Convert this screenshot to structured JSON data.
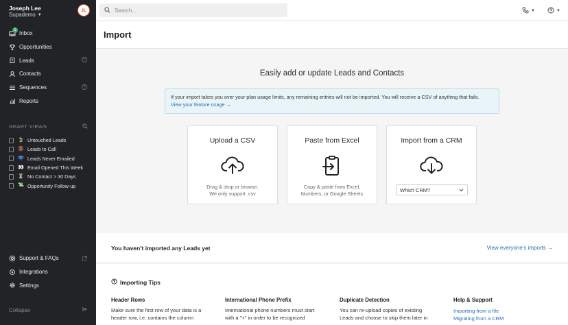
{
  "user": {
    "name": "Joseph Lee",
    "org": "Supademo",
    "initials": "JL"
  },
  "nav": [
    {
      "label": "Inbox",
      "icon": "inbox-icon",
      "badge": "1"
    },
    {
      "label": "Opportunities",
      "icon": "trophy-icon"
    },
    {
      "label": "Leads",
      "icon": "building-icon",
      "add": "+"
    },
    {
      "label": "Contacts",
      "icon": "person-icon"
    },
    {
      "label": "Sequences",
      "icon": "list-icon",
      "add": "+"
    },
    {
      "label": "Reports",
      "icon": "chart-icon"
    }
  ],
  "smart_views": {
    "header": "SMART VIEWS",
    "items": [
      {
        "label": "Untouched Leads",
        "emoji": "🍃"
      },
      {
        "label": "Leads to Call",
        "emoji": "📵"
      },
      {
        "label": "Leads Never Emailed",
        "emoji": "📪"
      },
      {
        "label": "Email Opened This Week",
        "emoji": "👀"
      },
      {
        "label": "No Contact > 30 Days",
        "emoji": "⏳"
      },
      {
        "label": "Opportunity Follow-up",
        "emoji": "💸"
      }
    ]
  },
  "bottom_nav": [
    {
      "label": "Support & FAQs",
      "icon": "lifebuoy-icon"
    },
    {
      "label": "Integrations",
      "icon": "plug-icon"
    },
    {
      "label": "Settings",
      "icon": "gear-icon"
    }
  ],
  "collapse_label": "Collapse",
  "search": {
    "placeholder": "Search..."
  },
  "page": {
    "title": "Import",
    "hero": "Easily add or update Leads and Contacts",
    "notice_text": "If your import takes you over your plan usage limits, any remaining entries will not be imported. You will receive a CSV of anything that fails.",
    "notice_link": "View your feature usage →"
  },
  "cards": [
    {
      "title": "Upload a CSV",
      "desc1": "Drag & drop or browse.",
      "desc2": "We only support .csv",
      "icon": "cloud-upload-icon"
    },
    {
      "title": "Paste from Excel",
      "desc1": "Copy & paste from Excel,",
      "desc2": "Numbers, or Google Sheets",
      "icon": "clipboard-paste-icon"
    },
    {
      "title": "Import from a CRM",
      "select": "Which CRM?",
      "icon": "cloud-download-icon"
    }
  ],
  "empty": {
    "title": "You haven't imported any Leads yet",
    "link": "View everyone's imports →"
  },
  "tips": {
    "title": "Importing Tips",
    "columns": [
      {
        "head": "Header Rows",
        "line1": "Make sure the first row of your data is a",
        "line2": "header row, i.e. contains the column"
      },
      {
        "head": "International Phone Prefix",
        "line1": "International phone numbers must start",
        "line2": "with a \"+\" in order to be recognized"
      },
      {
        "head": "Duplicate Detection",
        "line1": "You can re-upload copies of existing",
        "line2": "Leads and choose to skip them later in"
      },
      {
        "head": "Help & Support",
        "links": [
          "Importing from a file",
          "Migrating from a CRM"
        ]
      }
    ]
  }
}
